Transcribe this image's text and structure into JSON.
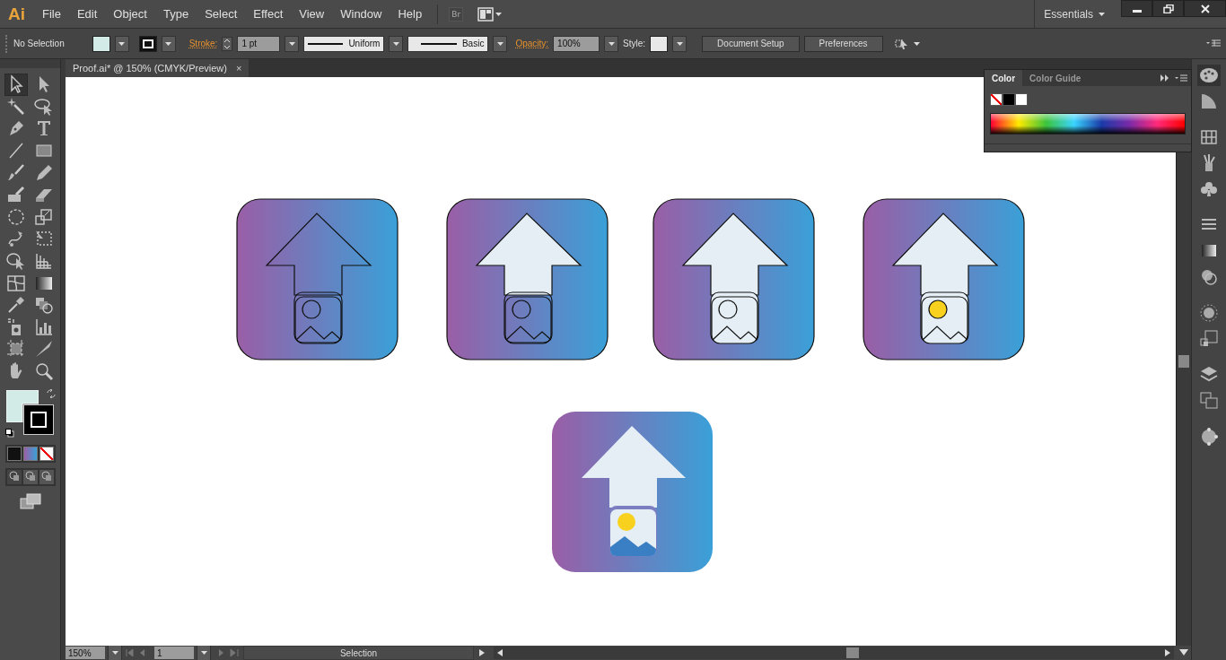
{
  "menu_bar": {
    "logo": "Ai",
    "menus": [
      "File",
      "Edit",
      "Object",
      "Type",
      "Select",
      "Effect",
      "View",
      "Window",
      "Help"
    ],
    "bridge": "Br",
    "workspace": "Essentials"
  },
  "control_bar": {
    "selection": "No Selection",
    "stroke_label": "Stroke:",
    "stroke_weight": "1 pt",
    "profile": "Uniform",
    "brush": "Basic",
    "opacity_label": "Opacity:",
    "opacity": "100%",
    "style_label": "Style:",
    "buttons": [
      "Document Setup",
      "Preferences"
    ]
  },
  "document_tab": {
    "title": "Proof.ai* @ 150% (CMYK/Preview)",
    "close": "×"
  },
  "tools": [
    {
      "kind": "selection",
      "selected": true
    },
    {
      "kind": "direct-selection",
      "selected": false
    },
    {
      "kind": "magic-wand",
      "selected": false
    },
    {
      "kind": "lasso",
      "selected": false
    },
    {
      "kind": "pen",
      "selected": false
    },
    {
      "kind": "type",
      "selected": false
    },
    {
      "kind": "line",
      "selected": false
    },
    {
      "kind": "rectangle",
      "selected": false
    },
    {
      "kind": "paintbrush",
      "selected": false
    },
    {
      "kind": "pencil",
      "selected": false
    },
    {
      "kind": "blob-brush",
      "selected": false
    },
    {
      "kind": "eraser",
      "selected": false
    },
    {
      "kind": "rotate",
      "selected": false
    },
    {
      "kind": "scale",
      "selected": false
    },
    {
      "kind": "warp",
      "selected": false
    },
    {
      "kind": "free-transform",
      "selected": false
    },
    {
      "kind": "shape-builder",
      "selected": false
    },
    {
      "kind": "perspective",
      "selected": false
    },
    {
      "kind": "mesh",
      "selected": false
    },
    {
      "kind": "gradient",
      "selected": false
    },
    {
      "kind": "eyedropper",
      "selected": false
    },
    {
      "kind": "blend",
      "selected": false
    },
    {
      "kind": "sprayer",
      "selected": false
    },
    {
      "kind": "graph",
      "selected": false
    },
    {
      "kind": "artboard",
      "selected": false
    },
    {
      "kind": "slice",
      "selected": false
    },
    {
      "kind": "hand",
      "selected": false
    },
    {
      "kind": "zoom",
      "selected": false
    }
  ],
  "color_panel": {
    "tabs": [
      {
        "label": "Color",
        "selected": true
      },
      {
        "label": "Color Guide",
        "selected": false
      }
    ]
  },
  "artboard": {
    "icons": [
      {
        "kind": "outline",
        "arrow_filled": false,
        "photo_filled": false,
        "sun_filled": false
      },
      {
        "kind": "outline",
        "arrow_filled": true,
        "photo_filled": false,
        "sun_filled": false
      },
      {
        "kind": "outline",
        "arrow_filled": true,
        "photo_filled": true,
        "sun_filled": false
      },
      {
        "kind": "outline",
        "arrow_filled": true,
        "photo_filled": true,
        "sun_filled": true
      },
      {
        "kind": "flat",
        "arrow_filled": true,
        "photo_filled": true,
        "sun_filled": true
      }
    ]
  },
  "status_bar": {
    "zoom": "150%",
    "page": "1",
    "tool": "Selection"
  }
}
